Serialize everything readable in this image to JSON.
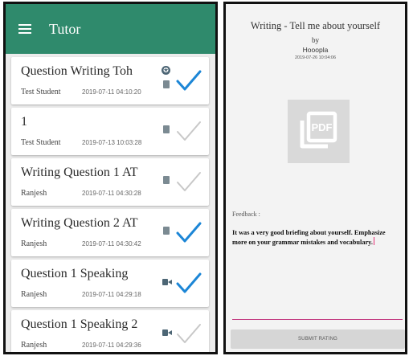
{
  "app": {
    "title": "Tutor"
  },
  "colors": {
    "appbar": "#2f8a6c",
    "check_active": "#1c86d6",
    "check_inactive": "#c8c8c8",
    "accent_line": "#c0307a"
  },
  "submissions": [
    {
      "title": "Question Writing Toh",
      "student": "Test Student",
      "date": "2019-07-11 04:10:20",
      "icons": [
        "badge-icon",
        "document-icon"
      ],
      "checked": true
    },
    {
      "title": "1",
      "student": "Test Student",
      "date": "2019-07-13 10:03:28",
      "icons": [
        "document-icon"
      ],
      "checked": false
    },
    {
      "title": "Writing Question 1 AT",
      "student": "Ranjesh",
      "date": "2019-07-11 04:30:28",
      "icons": [
        "document-icon"
      ],
      "checked": false
    },
    {
      "title": "Writing Question 2 AT",
      "student": "Ranjesh",
      "date": "2019-07-11 04:30:42",
      "icons": [
        "document-icon"
      ],
      "checked": true
    },
    {
      "title": "Question 1 Speaking",
      "student": "Ranjesh",
      "date": "2019-07-11 04:29:18",
      "icons": [
        "video-icon"
      ],
      "checked": true
    },
    {
      "title": "Question 1 Speaking 2",
      "student": "Ranjesh",
      "date": "2019-07-11 04:29:36",
      "icons": [
        "video-icon"
      ],
      "checked": false
    }
  ],
  "detail": {
    "title": "Writing - Tell me about yourself",
    "by_label": "by",
    "author": "Hooopla",
    "date": "2019-07-26 10:04:06",
    "attachment_icon": "pdf-file-icon",
    "attachment_label": "PDF",
    "feedback_label": "Feedback :",
    "feedback_text": "It was a very good briefing about yourself. Emphasize more on your grammar mistakes and vocabulary.",
    "submit_label": "SUBMIT RATING"
  }
}
